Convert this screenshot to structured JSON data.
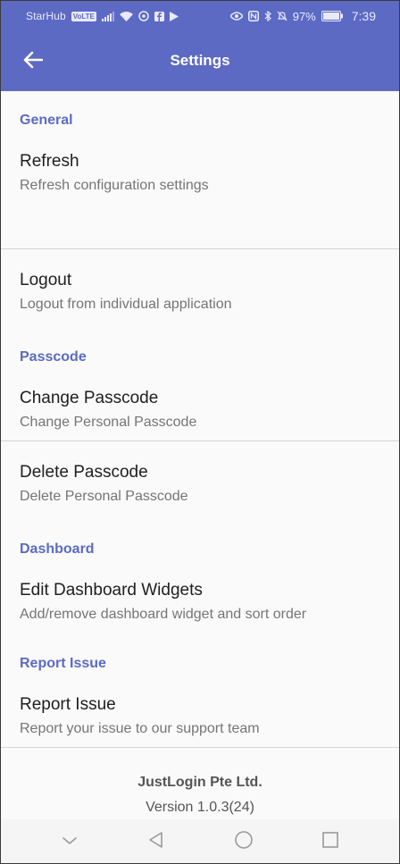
{
  "status_bar": {
    "carrier": "StarHub",
    "network_badge": "VoLTE",
    "battery_percent": "97%",
    "time": "7:39",
    "icons": [
      "signal-icon",
      "wifi-icon",
      "whatsapp-icon",
      "facebook-icon",
      "play-store-icon",
      "eye-icon",
      "nfc-icon",
      "bluetooth-icon",
      "mute-bell-icon",
      "battery-icon"
    ]
  },
  "appbar": {
    "title": "Settings",
    "back_icon": "arrow-left-icon"
  },
  "colors": {
    "primary": "#5c6ac4",
    "background": "#fafafa",
    "divider": "#d4d4d4"
  },
  "sections": [
    {
      "header": "General",
      "items": [
        {
          "title": "Refresh",
          "subtitle": "Refresh configuration settings"
        },
        {
          "title": "Logout",
          "subtitle": "Logout from individual application"
        }
      ]
    },
    {
      "header": "Passcode",
      "items": [
        {
          "title": "Change Passcode",
          "subtitle": "Change Personal Passcode"
        },
        {
          "title": "Delete Passcode",
          "subtitle": "Delete Personal Passcode"
        }
      ]
    },
    {
      "header": "Dashboard",
      "items": [
        {
          "title": "Edit Dashboard Widgets",
          "subtitle": "Add/remove dashboard widget and sort order"
        }
      ]
    },
    {
      "header": "Report Issue",
      "items": [
        {
          "title": "Report Issue",
          "subtitle": "Report your issue to our support team"
        }
      ]
    }
  ],
  "footer": {
    "company": "JustLogin Pte Ltd.",
    "version": "Version 1.0.3(24)"
  },
  "nav_bar": {
    "icons": [
      "hide-keyboard-icon",
      "back-triangle-icon",
      "home-circle-icon",
      "recents-square-icon"
    ]
  }
}
